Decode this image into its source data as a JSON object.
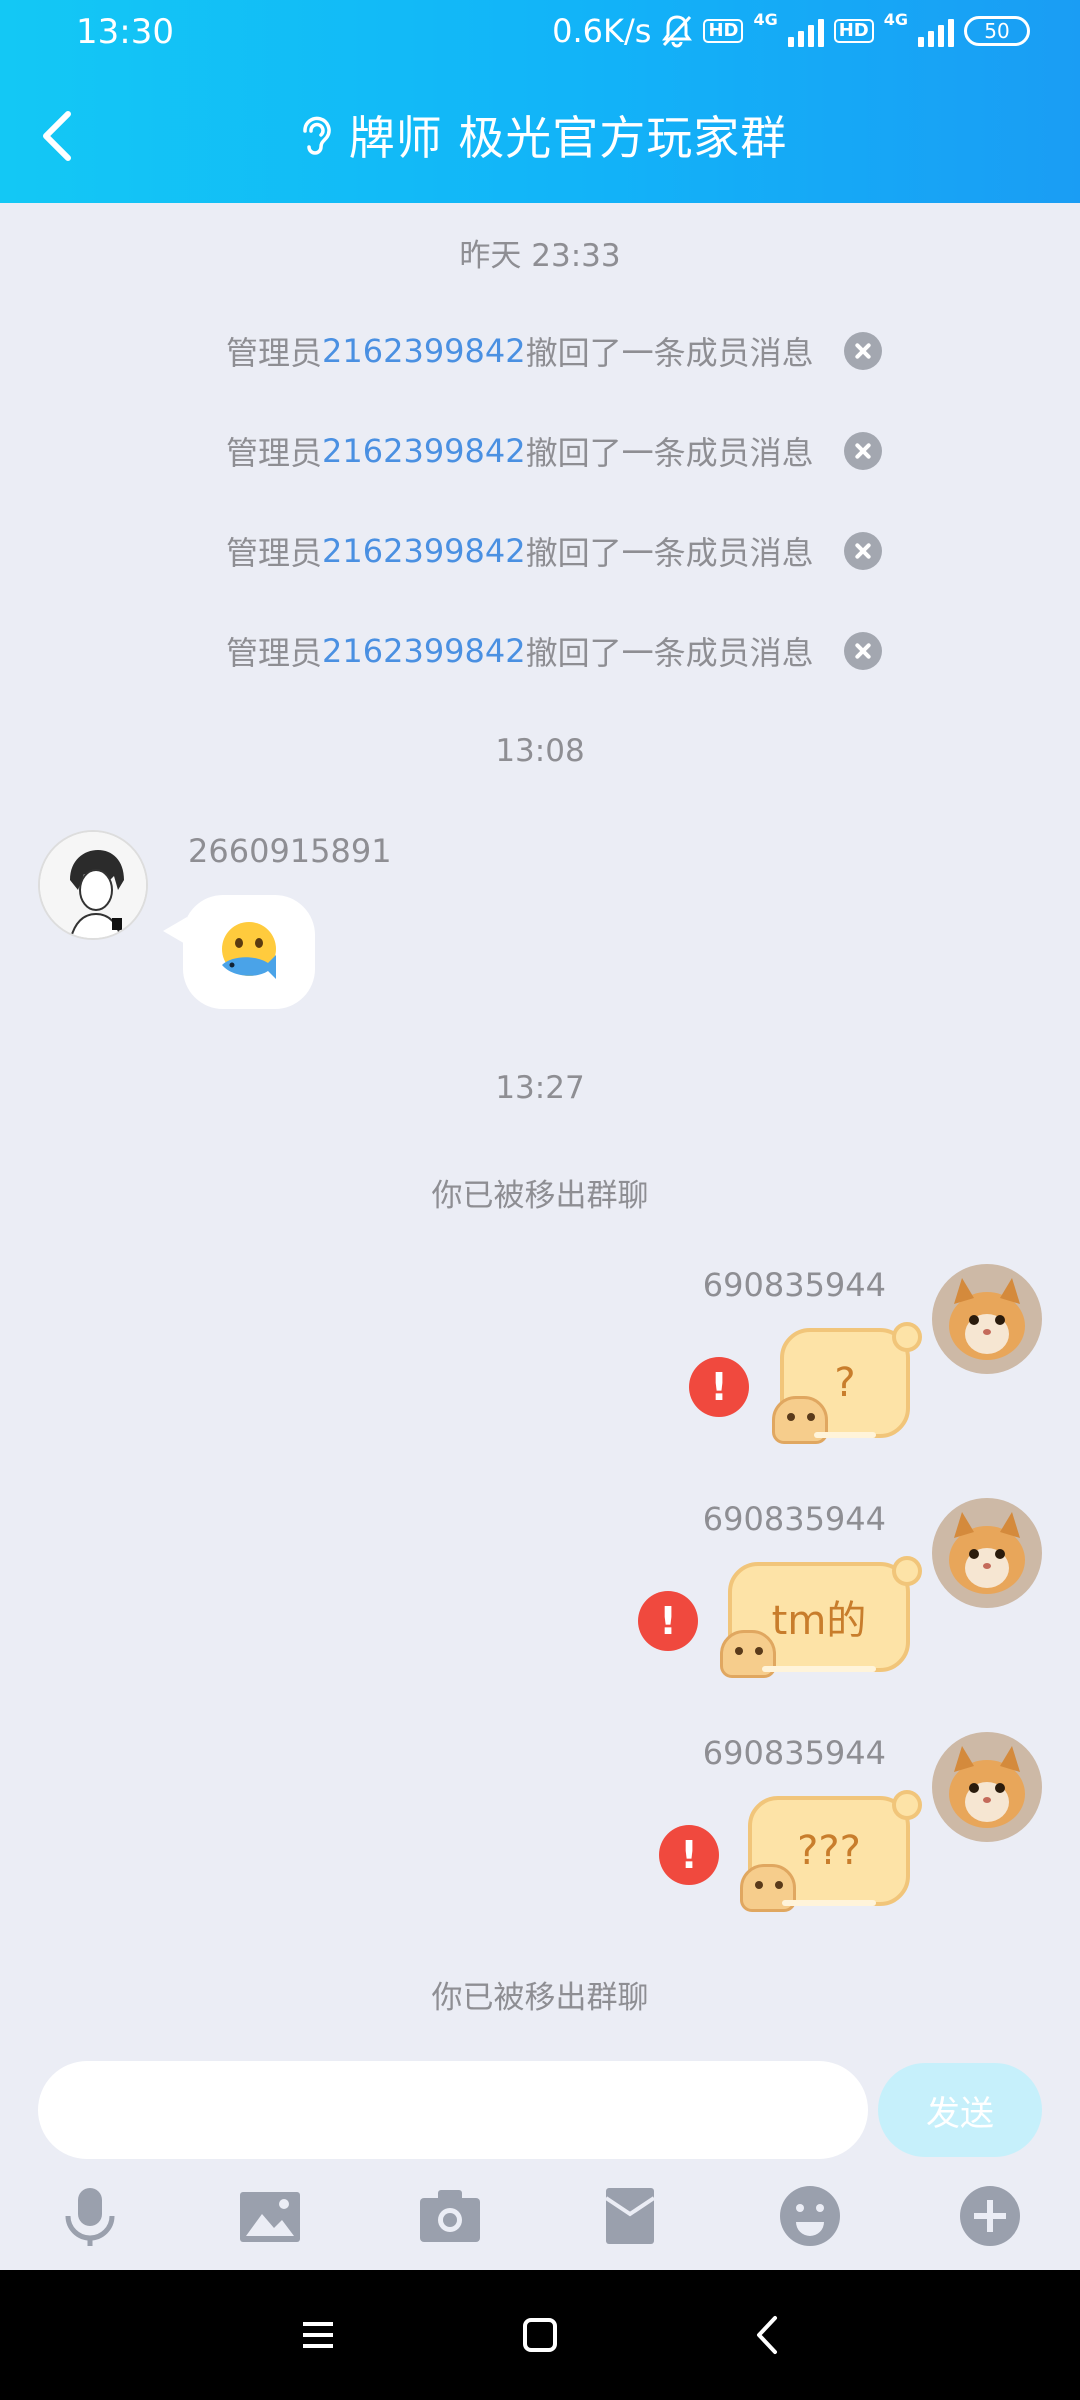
{
  "status_bar": {
    "time": "13:30",
    "speed": "0.6K/s",
    "hd": "HD",
    "network": "4G",
    "battery": "50"
  },
  "header": {
    "title": "牌师 极光官方玩家群"
  },
  "chat": {
    "timestamp_1": "昨天 23:33",
    "recalls": [
      {
        "prefix": "管理员",
        "id": "2162399842",
        "suffix": "撤回了一条成员消息"
      },
      {
        "prefix": "管理员",
        "id": "2162399842",
        "suffix": "撤回了一条成员消息"
      },
      {
        "prefix": "管理员",
        "id": "2162399842",
        "suffix": "撤回了一条成员消息"
      },
      {
        "prefix": "管理员",
        "id": "2162399842",
        "suffix": "撤回了一条成员消息"
      }
    ],
    "timestamp_2": "13:08",
    "other_message": {
      "sender": "2660915891",
      "content": "emoji-fish-mouth"
    },
    "timestamp_3": "13:27",
    "notice_1": "你已被移出群聊",
    "my_messages": [
      {
        "sender": "690835944",
        "text": "?",
        "failed": "!"
      },
      {
        "sender": "690835944",
        "text": "tm的",
        "failed": "!"
      },
      {
        "sender": "690835944",
        "text": "???",
        "failed": "!"
      }
    ],
    "notice_2": "你已被移出群聊"
  },
  "input_bar": {
    "placeholder": "",
    "send_label": "发送"
  },
  "toolbar_icons": [
    "microphone-icon",
    "image-icon",
    "camera-icon",
    "red-envelope-icon",
    "emoji-icon",
    "plus-icon"
  ],
  "colors": {
    "header_gradient_start": "#13c8f5",
    "header_gradient_end": "#1a9df4",
    "link_blue": "#4a90e2",
    "error_red": "#f0493e",
    "background": "#ebedf5"
  }
}
